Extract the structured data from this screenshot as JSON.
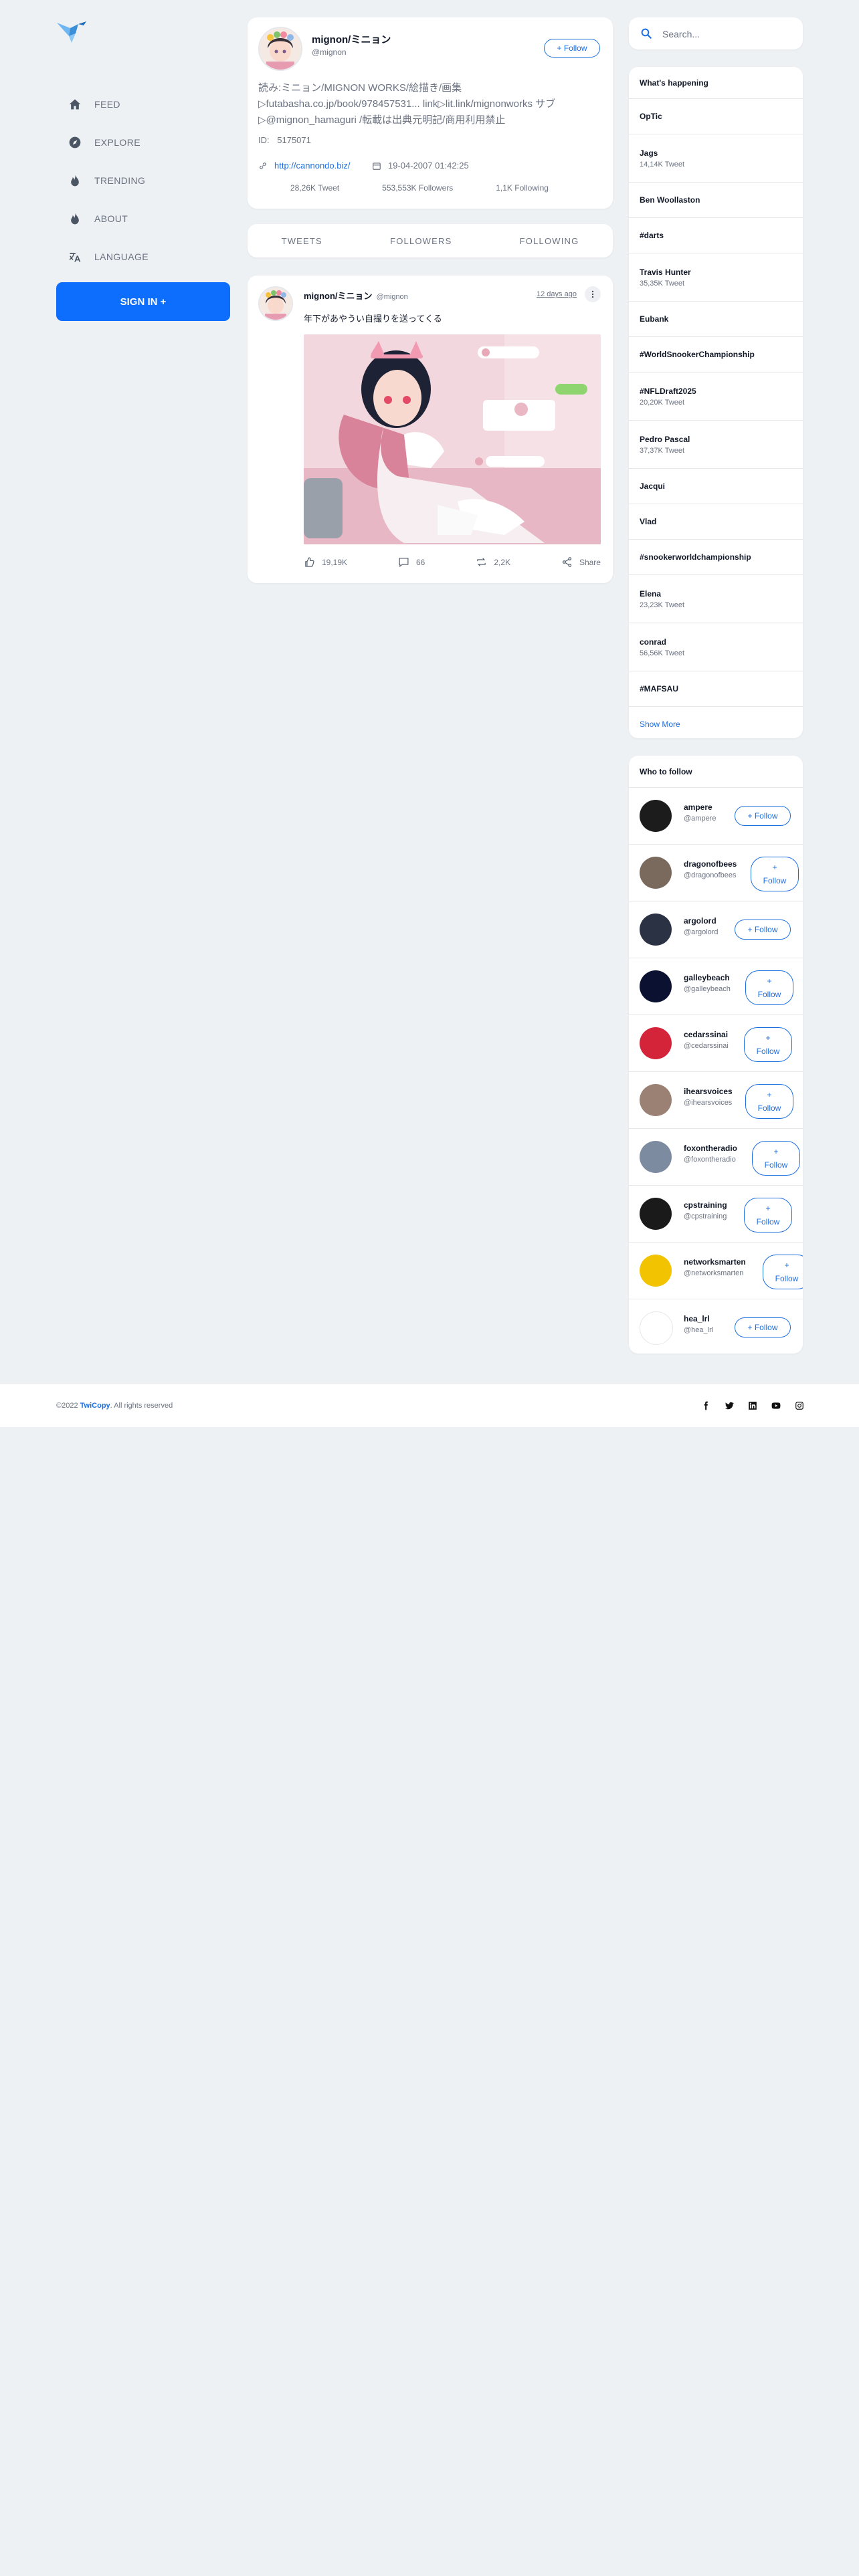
{
  "nav": {
    "items": [
      {
        "label": "FEED",
        "icon": "home-icon"
      },
      {
        "label": "EXPLORE",
        "icon": "compass-icon"
      },
      {
        "label": "TRENDING",
        "icon": "flame-icon"
      },
      {
        "label": "ABOUT",
        "icon": "flame-icon"
      },
      {
        "label": "LANGUAGE",
        "icon": "translate-icon"
      }
    ],
    "signin": "SIGN IN +"
  },
  "profile": {
    "name": "mignon/ミニョン",
    "handle": "@mignon",
    "follow": "+ Follow",
    "bio": [
      "読み:ミニョン/MIGNON WORKS/絵描き/画集",
      "▷futabasha.co.jp/book/978457531... link▷lit.link/mignonworks サブ",
      "▷@mignon_hamaguri /転載は出典元明記/商用利用禁止"
    ],
    "id_label": "ID:",
    "id_value": "5175071",
    "link": "http://cannondo.biz/",
    "joined": "19-04-2007 01:42:25",
    "tweets": "28,26K Tweet",
    "followers": "553,553K Followers",
    "following": "1,1K Following"
  },
  "tabs": [
    "TWEETS",
    "FOLLOWERS",
    "FOLLOWING"
  ],
  "tweet": {
    "name": "mignon/ミニョン",
    "handle": "@mignon",
    "time": "12 days ago",
    "text": "年下があやうい自撮りを送ってくる",
    "likes": "19,19K",
    "comments": "66",
    "retweets": "2,2K",
    "share": "Share"
  },
  "search": {
    "placeholder": "Search..."
  },
  "trends": {
    "title": "What's happening",
    "items": [
      {
        "name": "OpTic",
        "count": ""
      },
      {
        "name": "Jags",
        "count": "14,14K Tweet"
      },
      {
        "name": "Ben Woollaston",
        "count": ""
      },
      {
        "name": "#darts",
        "count": ""
      },
      {
        "name": "Travis Hunter",
        "count": "35,35K Tweet"
      },
      {
        "name": "Eubank",
        "count": ""
      },
      {
        "name": "#WorldSnookerChampionship",
        "count": ""
      },
      {
        "name": "#NFLDraft2025",
        "count": "20,20K Tweet"
      },
      {
        "name": "Pedro Pascal",
        "count": "37,37K Tweet"
      },
      {
        "name": "Jacqui",
        "count": ""
      },
      {
        "name": "Vlad",
        "count": ""
      },
      {
        "name": "#snookerworldchampionship",
        "count": ""
      },
      {
        "name": "Elena",
        "count": "23,23K Tweet"
      },
      {
        "name": "conrad",
        "count": "56,56K Tweet"
      },
      {
        "name": "#MAFSAU",
        "count": ""
      }
    ],
    "show_more": "Show More"
  },
  "who_to_follow": {
    "title": "Who to follow",
    "users": [
      {
        "name": "ampere",
        "handle": "@ampere",
        "follow_lines": [
          "+ Follow"
        ],
        "avatar_color": "#1c1c1c"
      },
      {
        "name": "dragonofbees",
        "handle": "@dragonofbees",
        "follow_lines": [
          "+",
          "Follow"
        ],
        "avatar_color": "#7a6a5e"
      },
      {
        "name": "argolord",
        "handle": "@argolord",
        "follow_lines": [
          "+ Follow"
        ],
        "avatar_color": "#2b3244"
      },
      {
        "name": "galleybeach",
        "handle": "@galleybeach",
        "follow_lines": [
          "+",
          "Follow"
        ],
        "avatar_color": "#0b1130"
      },
      {
        "name": "cedarssinai",
        "handle": "@cedarssinai",
        "follow_lines": [
          "+",
          "Follow"
        ],
        "avatar_color": "#d3243a"
      },
      {
        "name": "ihearsvoices",
        "handle": "@ihearsvoices",
        "follow_lines": [
          "+",
          "Follow"
        ],
        "avatar_color": "#9a8174"
      },
      {
        "name": "foxontheradio",
        "handle": "@foxontheradio",
        "follow_lines": [
          "+",
          "Follow"
        ],
        "avatar_color": "#7d8ba0"
      },
      {
        "name": "cpstraining",
        "handle": "@cpstraining",
        "follow_lines": [
          "+",
          "Follow"
        ],
        "avatar_color": "#1a1a1a"
      },
      {
        "name": "networksmarten",
        "handle": "@networksmarten",
        "follow_lines": [
          "+",
          "Follow"
        ],
        "avatar_color": "#f2c300"
      },
      {
        "name": "hea_lrl",
        "handle": "@hea_lrl",
        "follow_lines": [
          "+ Follow"
        ],
        "avatar_color": "#ffffff"
      }
    ]
  },
  "footer": {
    "year": "©2022",
    "brand": "TwiCopy",
    "rights": ". All rights reserved",
    "social": [
      "facebook-icon",
      "twitter-icon",
      "linkedin-icon",
      "youtube-icon",
      "instagram-icon"
    ]
  },
  "colors": {
    "accent": "#0d6efd",
    "link": "#1d6fe0",
    "background": "#eef1f4"
  }
}
